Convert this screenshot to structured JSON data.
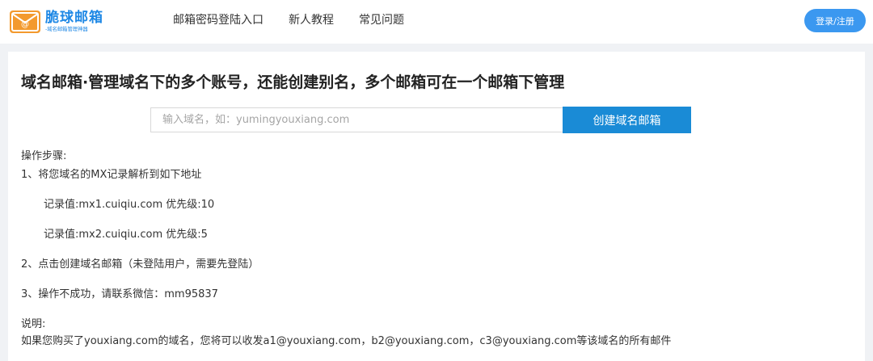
{
  "header": {
    "logo_name": "脆球邮箱",
    "logo_sub": "-域名邮箱管理神器",
    "nav": [
      "邮箱密码登陆入口",
      "新人教程",
      "常见问题"
    ],
    "login_label": "登录/注册"
  },
  "main": {
    "headline": "域名邮箱·管理域名下的多个账号，还能创建别名，多个邮箱可在一个邮箱下管理",
    "search": {
      "placeholder": "输入域名，如：yumingyouxiang.com",
      "value": "",
      "button_label": "创建域名邮箱"
    },
    "steps_title": "操作步骤:",
    "step1": "1、将您域名的MX记录解析到如下地址",
    "mx_records": [
      "记录值:mx1.cuiqiu.com 优先级:10",
      "记录值:mx2.cuiqiu.com 优先级:5"
    ],
    "step2": "2、点击创建域名邮箱（未登陆用户，需要先登陆）",
    "step3": "3、操作不成功，请联系微信：mm95837",
    "note_title": "说明:",
    "note_text": "如果您购买了youxiang.com的域名，您将可以收发a1@youxiang.com，b2@youxiang.com，c3@youxiang.com等该域名的所有邮件"
  },
  "colors": {
    "brand": "#1e88e5",
    "logo_orange": "#f39a2e",
    "button_blue": "#1a8bd6",
    "login_blue": "#3b98f0"
  }
}
